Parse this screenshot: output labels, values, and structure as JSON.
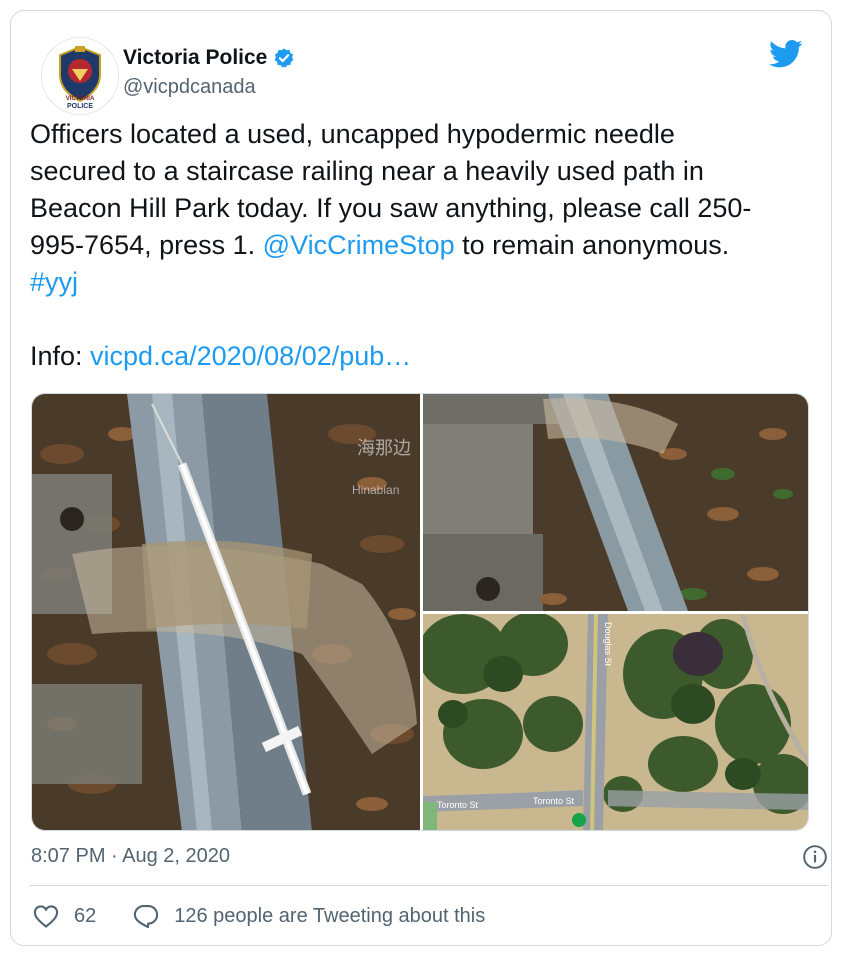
{
  "tweet": {
    "author_name": "Victoria Police",
    "handle": "@vicpdcanada",
    "verified": true,
    "logo_text_top": "VICTORIA",
    "logo_text_bottom": "POLICE",
    "text_part1": "Officers located a used, uncapped hypodermic needle secured to a staircase railing near a heavily used path in Beacon Hill Park today. If you saw anything, please call 250-995-7654, press 1. ",
    "mention": "@VicCrimeStop",
    "text_part2": " to remain anonymous. ",
    "hashtag": "#yyj",
    "info_label": "Info: ",
    "info_link": "vicpd.ca/2020/08/02/pub…",
    "timestamp": "8:07 PM · Aug 2, 2020",
    "likes": "62",
    "replies_text": "126 people are Tweeting about this"
  },
  "media": {
    "watermark": "海那边",
    "watermark_sub": "Hinabian",
    "map_street_1": "Toronto St",
    "map_street_2": "Toronto St",
    "map_street_3": "Douglas St"
  },
  "icons": {
    "bird": "twitter-bird-icon",
    "verified": "verified-badge-icon",
    "info": "info-icon",
    "like": "heart-icon",
    "reply": "speech-bubble-icon"
  },
  "colors": {
    "link": "#1d9bf0",
    "muted": "#536471",
    "border": "#cfd9de"
  }
}
